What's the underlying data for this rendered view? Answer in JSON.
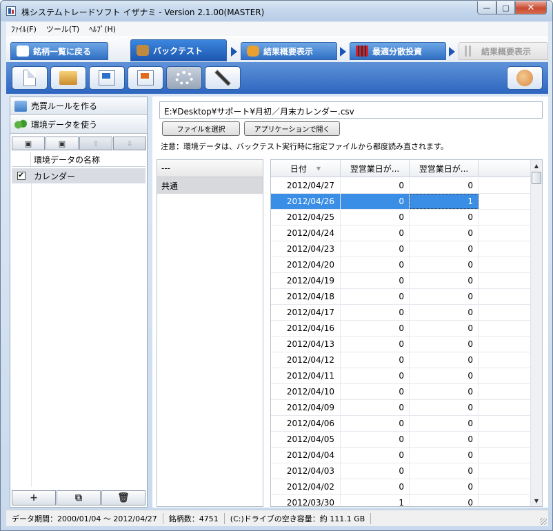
{
  "window": {
    "title": "株システムトレードソフト イザナミ - Version 2.1.00(MASTER)",
    "min_glyph": "—",
    "max_glyph": "□",
    "close_glyph": "✕"
  },
  "menu": [
    "ﾌｧｲﾙ(F)",
    "ツール(T)",
    "ﾍﾙﾌﾟ(H)"
  ],
  "tabs": {
    "back": "銘柄一覧に戻る",
    "backtest": "バックテスト",
    "summary": "結果概要表示",
    "optimal": "最適分散投資",
    "summary2": "結果概要表示"
  },
  "left_panel": {
    "make_rule": "売買ルールを作る",
    "use_env": "環境データを使う",
    "toolbar_icons": [
      "save-icon",
      "save-as-icon",
      "up-arrow-icon",
      "down-arrow-icon"
    ],
    "column_header": "環境データの名称",
    "rows": [
      {
        "checked": true,
        "check_glyph": "✔",
        "name": "カレンダー"
      }
    ],
    "bottom_buttons": {
      "add": "+",
      "copy": "⧉",
      "delete": "🗑"
    }
  },
  "right_panel": {
    "file_path": "E:¥Desktop¥サポート¥月初／月末カレンダー.csv",
    "select_file": "ファイルを選択",
    "open_app": "アプリケーションで開く",
    "note": "注意：環境データは、バックテスト実行時に指定ファイルから都度読み直されます。",
    "list_header": "---",
    "list_items": [
      "共通"
    ]
  },
  "grid": {
    "headers": {
      "date": "日付",
      "col1": "翌営業日が...",
      "col2": "翌営業日が..."
    },
    "sort_glyph": "▼",
    "scroll_up": "▲",
    "scroll_down": "▼",
    "selected_index": 1,
    "rows": [
      [
        "2012/04/27",
        "0",
        "0"
      ],
      [
        "2012/04/26",
        "0",
        "1"
      ],
      [
        "2012/04/25",
        "0",
        "0"
      ],
      [
        "2012/04/24",
        "0",
        "0"
      ],
      [
        "2012/04/23",
        "0",
        "0"
      ],
      [
        "2012/04/20",
        "0",
        "0"
      ],
      [
        "2012/04/19",
        "0",
        "0"
      ],
      [
        "2012/04/18",
        "0",
        "0"
      ],
      [
        "2012/04/17",
        "0",
        "0"
      ],
      [
        "2012/04/16",
        "0",
        "0"
      ],
      [
        "2012/04/13",
        "0",
        "0"
      ],
      [
        "2012/04/12",
        "0",
        "0"
      ],
      [
        "2012/04/11",
        "0",
        "0"
      ],
      [
        "2012/04/10",
        "0",
        "0"
      ],
      [
        "2012/04/09",
        "0",
        "0"
      ],
      [
        "2012/04/06",
        "0",
        "0"
      ],
      [
        "2012/04/05",
        "0",
        "0"
      ],
      [
        "2012/04/04",
        "0",
        "0"
      ],
      [
        "2012/04/03",
        "0",
        "0"
      ],
      [
        "2012/04/02",
        "0",
        "0"
      ],
      [
        "2012/03/30",
        "1",
        "0"
      ]
    ]
  },
  "status": {
    "period": "データ期間：2000/01/04 〜 2012/04/27",
    "count": "銘柄数：4751",
    "disk": "(C:)ドライブの空き容量：約 111.1 GB"
  },
  "colors": {
    "accent": "#2f6fc4",
    "selection": "#3a8ee6"
  }
}
